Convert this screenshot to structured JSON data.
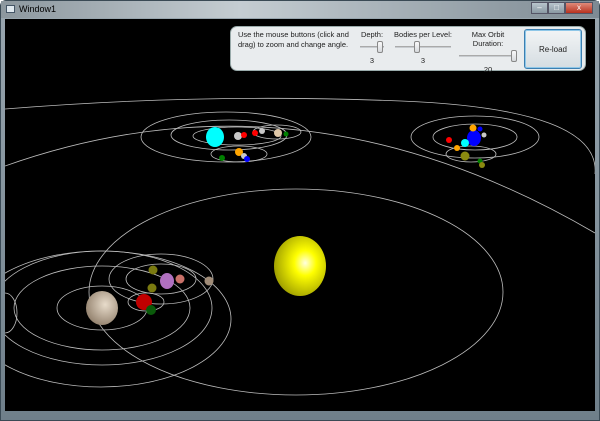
{
  "window": {
    "title": "Window1",
    "minimize": "–",
    "maximize": "□",
    "close": "x"
  },
  "panel": {
    "hint": "Use the mouse buttons (click and drag) to zoom and change angle.",
    "depth": {
      "label": "Depth:",
      "value": "3",
      "fraction": 0.9
    },
    "bodies": {
      "label": "Bodies per Level:",
      "value": "3",
      "fraction": 0.5
    },
    "duration": {
      "label": "Max Orbit Duration:",
      "value": "20",
      "fraction": 1.0
    },
    "reload_label": "Re-load"
  },
  "colors": {
    "sun": "#ffff00",
    "orbit": "#bdbdbd",
    "background": "#000000"
  }
}
